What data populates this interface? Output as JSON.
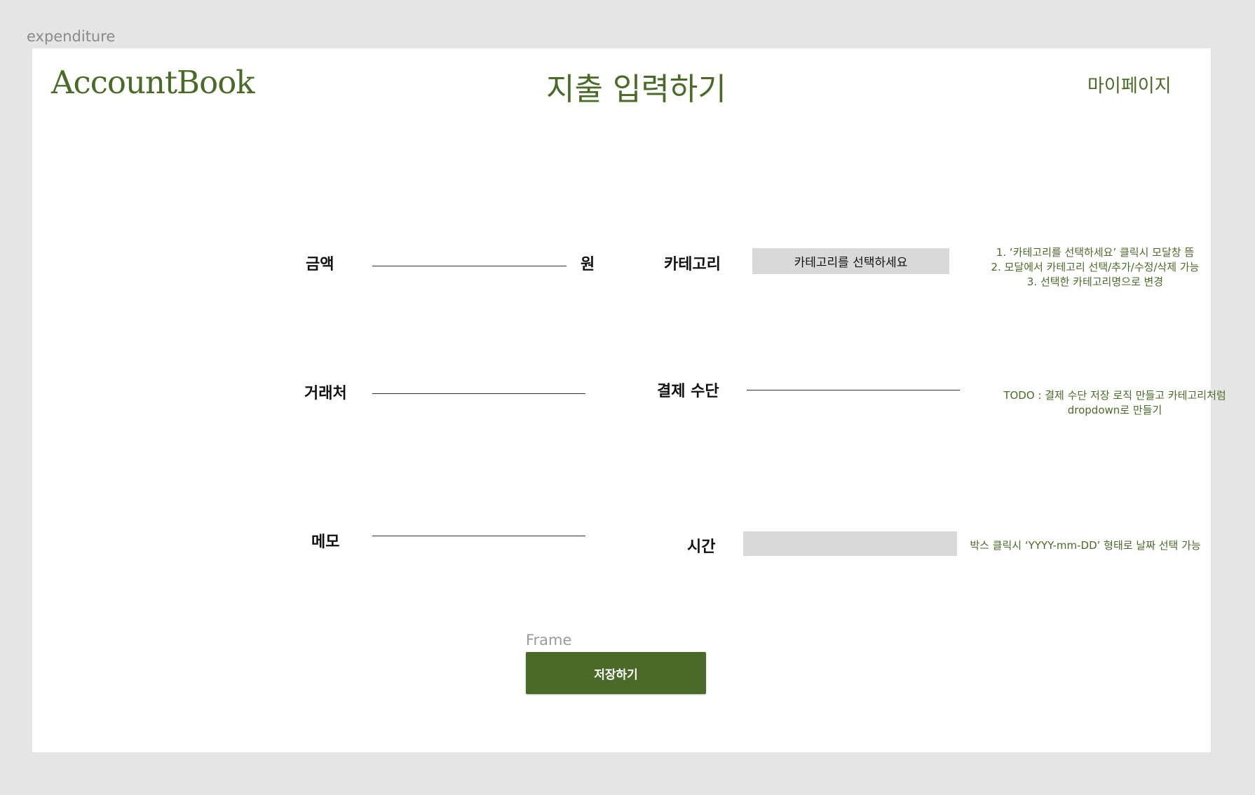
{
  "canvas": {
    "frame_name": "expenditure"
  },
  "header": {
    "logo": "AccountBook",
    "title": "지출 입력하기",
    "mypage_link": "마이페이지"
  },
  "form": {
    "amount": {
      "label": "금액",
      "value": "",
      "unit": "원"
    },
    "vendor": {
      "label": "거래처",
      "value": ""
    },
    "memo": {
      "label": "메모",
      "value": ""
    },
    "category": {
      "label": "카테고리",
      "placeholder": "카테고리를 선택하세요"
    },
    "payment": {
      "label": "결제 수단",
      "value": ""
    },
    "time": {
      "label": "시간",
      "value": ""
    }
  },
  "notes": {
    "category": [
      "1. ‘카테고리를 선택하세요’ 클릭시 모달창 뜸",
      "2. 모달에서 카테고리 선택/추가/수정/삭제 가능",
      "3. 선택한 카테고리명으로 변경"
    ],
    "payment": [
      "TODO : 결제 수단 저장 로직 만들고 카테고리처럼",
      "dropdown로 만들기"
    ],
    "time": "박스 클릭시 ‘YYYY-mm-DD’ 형태로 날짜 선택 가능"
  },
  "save": {
    "frame_label": "Frame",
    "button_label": "저장하기"
  },
  "colors": {
    "accent": "#4a6b27",
    "canvas_bg": "#e5e5e5",
    "input_box": "#d9d9d9"
  }
}
